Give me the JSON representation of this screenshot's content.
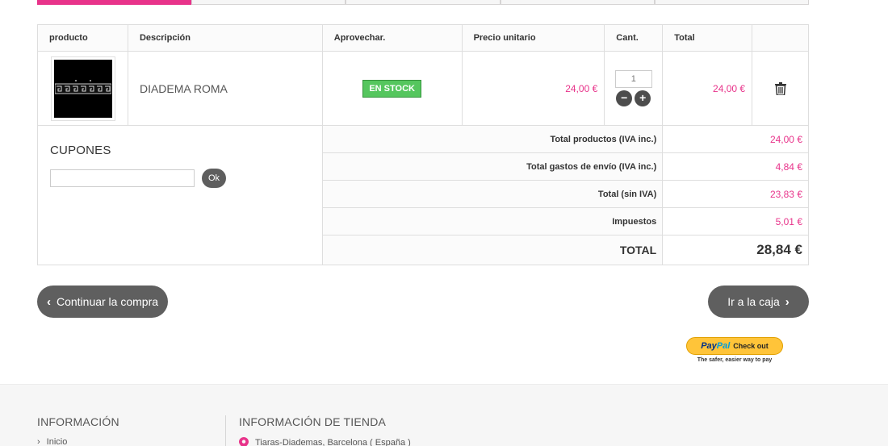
{
  "cart": {
    "headers": [
      "producto",
      "Descripción",
      "Aprovechar.",
      "Precio unitario",
      "Cant.",
      "Total",
      ""
    ],
    "items": [
      {
        "image_icon": "tiara-product-image",
        "description": "DIADEMA ROMA",
        "availability": "EN STOCK",
        "unit_price": "24,00 €",
        "quantity": "1",
        "total": "24,00 €",
        "decrease_icon": "−",
        "increase_icon": "+",
        "delete_icon": "trash-icon"
      }
    ]
  },
  "coupon": {
    "title": "CUPONES",
    "input_value": "",
    "button_label": "Ok"
  },
  "summary": {
    "products_label": "Total productos (IVA inc.)",
    "products_value": "24,00 €",
    "shipping_label": "Total gastos de envío (IVA inc.)",
    "shipping_value": "4,84 €",
    "no_tax_label": "Total (sin IVA)",
    "no_tax_value": "23,83 €",
    "tax_label": "Impuestos",
    "tax_value": "5,01 €",
    "total_label": "TOTAL",
    "total_value": "28,84 €"
  },
  "actions": {
    "continue_label": "Continuar la compra",
    "continue_icon": "‹",
    "checkout_label": "Ir a la caja",
    "checkout_icon": "›"
  },
  "paypal": {
    "logo_part1": "Pay",
    "logo_part2": "Pal",
    "button_text": "Check out",
    "tagline": "The safer, easier way to pay"
  },
  "footer": {
    "info_title": "INFORMACIÓN",
    "info_link": "Inicio",
    "info_link_icon": "›",
    "store_title": "INFORMACIÓN DE TIENDA",
    "store_address": "Tiaras-Diademas, Barcelona ( España )"
  },
  "colors": {
    "accent": "#e8338a",
    "stock_green": "#55c65e",
    "button_dark": "#5f5f5f",
    "paypal_yellow": "#ffc439"
  }
}
